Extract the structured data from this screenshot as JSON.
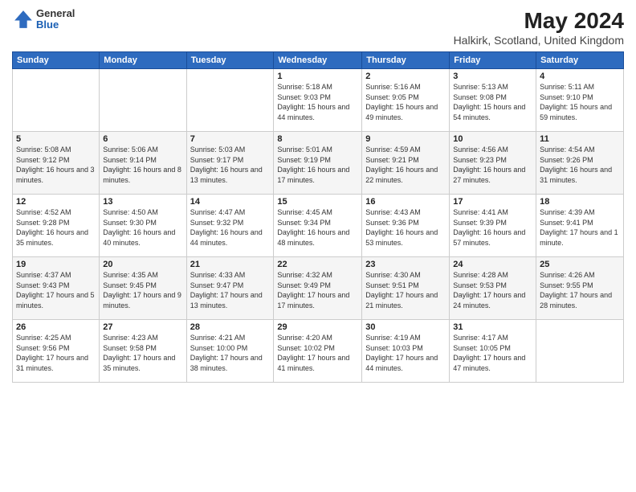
{
  "header": {
    "logo_general": "General",
    "logo_blue": "Blue",
    "title": "May 2024",
    "subtitle": "Halkirk, Scotland, United Kingdom"
  },
  "weekdays": [
    "Sunday",
    "Monday",
    "Tuesday",
    "Wednesday",
    "Thursday",
    "Friday",
    "Saturday"
  ],
  "weeks": [
    [
      {
        "day": "",
        "info": ""
      },
      {
        "day": "",
        "info": ""
      },
      {
        "day": "",
        "info": ""
      },
      {
        "day": "1",
        "info": "Sunrise: 5:18 AM\nSunset: 9:03 PM\nDaylight: 15 hours\nand 44 minutes."
      },
      {
        "day": "2",
        "info": "Sunrise: 5:16 AM\nSunset: 9:05 PM\nDaylight: 15 hours\nand 49 minutes."
      },
      {
        "day": "3",
        "info": "Sunrise: 5:13 AM\nSunset: 9:08 PM\nDaylight: 15 hours\nand 54 minutes."
      },
      {
        "day": "4",
        "info": "Sunrise: 5:11 AM\nSunset: 9:10 PM\nDaylight: 15 hours\nand 59 minutes."
      }
    ],
    [
      {
        "day": "5",
        "info": "Sunrise: 5:08 AM\nSunset: 9:12 PM\nDaylight: 16 hours\nand 3 minutes."
      },
      {
        "day": "6",
        "info": "Sunrise: 5:06 AM\nSunset: 9:14 PM\nDaylight: 16 hours\nand 8 minutes."
      },
      {
        "day": "7",
        "info": "Sunrise: 5:03 AM\nSunset: 9:17 PM\nDaylight: 16 hours\nand 13 minutes."
      },
      {
        "day": "8",
        "info": "Sunrise: 5:01 AM\nSunset: 9:19 PM\nDaylight: 16 hours\nand 17 minutes."
      },
      {
        "day": "9",
        "info": "Sunrise: 4:59 AM\nSunset: 9:21 PM\nDaylight: 16 hours\nand 22 minutes."
      },
      {
        "day": "10",
        "info": "Sunrise: 4:56 AM\nSunset: 9:23 PM\nDaylight: 16 hours\nand 27 minutes."
      },
      {
        "day": "11",
        "info": "Sunrise: 4:54 AM\nSunset: 9:26 PM\nDaylight: 16 hours\nand 31 minutes."
      }
    ],
    [
      {
        "day": "12",
        "info": "Sunrise: 4:52 AM\nSunset: 9:28 PM\nDaylight: 16 hours\nand 35 minutes."
      },
      {
        "day": "13",
        "info": "Sunrise: 4:50 AM\nSunset: 9:30 PM\nDaylight: 16 hours\nand 40 minutes."
      },
      {
        "day": "14",
        "info": "Sunrise: 4:47 AM\nSunset: 9:32 PM\nDaylight: 16 hours\nand 44 minutes."
      },
      {
        "day": "15",
        "info": "Sunrise: 4:45 AM\nSunset: 9:34 PM\nDaylight: 16 hours\nand 48 minutes."
      },
      {
        "day": "16",
        "info": "Sunrise: 4:43 AM\nSunset: 9:36 PM\nDaylight: 16 hours\nand 53 minutes."
      },
      {
        "day": "17",
        "info": "Sunrise: 4:41 AM\nSunset: 9:39 PM\nDaylight: 16 hours\nand 57 minutes."
      },
      {
        "day": "18",
        "info": "Sunrise: 4:39 AM\nSunset: 9:41 PM\nDaylight: 17 hours\nand 1 minute."
      }
    ],
    [
      {
        "day": "19",
        "info": "Sunrise: 4:37 AM\nSunset: 9:43 PM\nDaylight: 17 hours\nand 5 minutes."
      },
      {
        "day": "20",
        "info": "Sunrise: 4:35 AM\nSunset: 9:45 PM\nDaylight: 17 hours\nand 9 minutes."
      },
      {
        "day": "21",
        "info": "Sunrise: 4:33 AM\nSunset: 9:47 PM\nDaylight: 17 hours\nand 13 minutes."
      },
      {
        "day": "22",
        "info": "Sunrise: 4:32 AM\nSunset: 9:49 PM\nDaylight: 17 hours\nand 17 minutes."
      },
      {
        "day": "23",
        "info": "Sunrise: 4:30 AM\nSunset: 9:51 PM\nDaylight: 17 hours\nand 21 minutes."
      },
      {
        "day": "24",
        "info": "Sunrise: 4:28 AM\nSunset: 9:53 PM\nDaylight: 17 hours\nand 24 minutes."
      },
      {
        "day": "25",
        "info": "Sunrise: 4:26 AM\nSunset: 9:55 PM\nDaylight: 17 hours\nand 28 minutes."
      }
    ],
    [
      {
        "day": "26",
        "info": "Sunrise: 4:25 AM\nSunset: 9:56 PM\nDaylight: 17 hours\nand 31 minutes."
      },
      {
        "day": "27",
        "info": "Sunrise: 4:23 AM\nSunset: 9:58 PM\nDaylight: 17 hours\nand 35 minutes."
      },
      {
        "day": "28",
        "info": "Sunrise: 4:21 AM\nSunset: 10:00 PM\nDaylight: 17 hours\nand 38 minutes."
      },
      {
        "day": "29",
        "info": "Sunrise: 4:20 AM\nSunset: 10:02 PM\nDaylight: 17 hours\nand 41 minutes."
      },
      {
        "day": "30",
        "info": "Sunrise: 4:19 AM\nSunset: 10:03 PM\nDaylight: 17 hours\nand 44 minutes."
      },
      {
        "day": "31",
        "info": "Sunrise: 4:17 AM\nSunset: 10:05 PM\nDaylight: 17 hours\nand 47 minutes."
      },
      {
        "day": "",
        "info": ""
      }
    ]
  ]
}
